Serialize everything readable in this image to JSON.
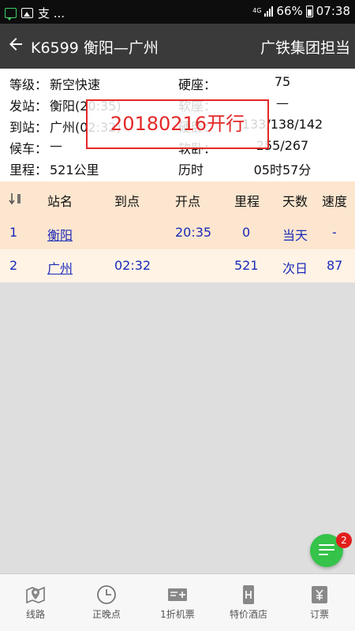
{
  "status_bar": {
    "left_text": "支 ...",
    "network": "4G",
    "battery": "66%",
    "time": "07:38"
  },
  "title_bar": {
    "title": "K6599 衡阳—广州",
    "right_text": "广铁集团担当"
  },
  "info": {
    "grade_label": "等级",
    "grade_value": "新空快速",
    "hard_seat_label": "硬座",
    "hard_seat_value": "75",
    "depart_label": "发站",
    "depart_value": "衡阳(20:35)",
    "soft_seat_label": "软座",
    "soft_seat_value": "—",
    "arrive_label": "到站",
    "arrive_value": "广州(02:32)",
    "hard_sleeper_label": "硬卧",
    "hard_sleeper_value": "133/138/142",
    "wait_label": "候车",
    "wait_value": "—",
    "soft_sleeper_label": "软卧",
    "soft_sleeper_value": "255/267",
    "distance_label": "里程",
    "distance_value": "521公里",
    "duration_label": "历时",
    "duration_value": "05时57分",
    "separator": "："
  },
  "stamp": "20180216开行",
  "table": {
    "headers": [
      "站名",
      "到点",
      "开点",
      "里程",
      "天数",
      "速度"
    ],
    "rows": [
      {
        "no": "1",
        "station": "衡阳",
        "arrive": "",
        "depart": "20:35",
        "distance": "0",
        "day": "当天",
        "speed": "-"
      },
      {
        "no": "2",
        "station": "广州",
        "arrive": "02:32",
        "depart": "",
        "distance": "521",
        "day": "次日",
        "speed": "87"
      }
    ]
  },
  "chat_badge": "2",
  "nav": {
    "items": [
      {
        "label": "线路",
        "icon": "map-pin-icon"
      },
      {
        "label": "正晚点",
        "icon": "clock-icon"
      },
      {
        "label": "1折机票",
        "icon": "ticket-plus-icon"
      },
      {
        "label": "特价酒店",
        "icon": "hotel-icon"
      },
      {
        "label": "订票",
        "icon": "yen-ticket-icon"
      }
    ]
  },
  "colors": {
    "link_blue": "#1a2ab8",
    "header_peach": "#fde6cf",
    "stamp_red": "#e32727",
    "chat_green": "#35c34a"
  }
}
